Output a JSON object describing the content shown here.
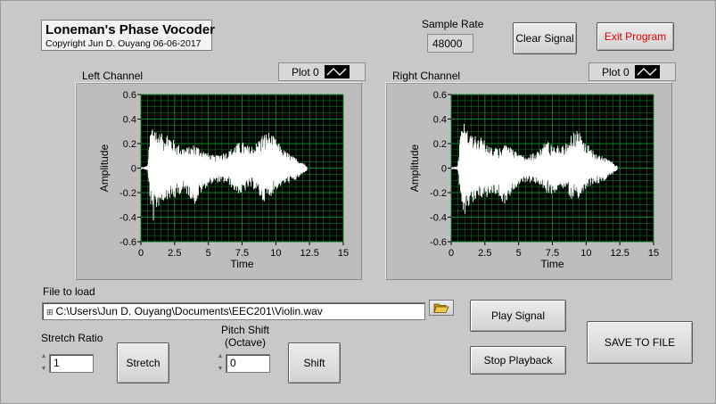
{
  "app": {
    "title": "Loneman's Phase Vocoder",
    "copyright": "Copyright Jun D. Ouyang 06-06-2017"
  },
  "sample_rate": {
    "label": "Sample Rate",
    "value": "48000"
  },
  "buttons": {
    "clear_signal": "Clear Signal",
    "exit_program": "Exit Program",
    "play_signal": "Play Signal",
    "stop_playback": "Stop Playback",
    "save_to_file": "SAVE TO FILE",
    "stretch": "Stretch",
    "shift": "Shift"
  },
  "left_graph": {
    "label": "Left Channel",
    "plot_legend": "Plot 0"
  },
  "right_graph": {
    "label": "Right Channel",
    "plot_legend": "Plot 0"
  },
  "file": {
    "label": "File to load",
    "path": "C:\\Users\\Jun D. Ouyang\\Documents\\EEC201\\Violin.wav"
  },
  "stretch_ratio": {
    "label": "Stretch Ratio",
    "value": "1"
  },
  "pitch_shift": {
    "label_line1": "Pitch Shift",
    "label_line2": "(Octave)",
    "value": "0"
  },
  "colors": {
    "plot_background": "#000000",
    "grid": "#0b8a2a",
    "trace": "#ffffff",
    "exit_text": "#e00000"
  },
  "chart_data": [
    {
      "type": "line",
      "title": "Left Channel",
      "xlabel": "Time",
      "ylabel": "Amplitude",
      "xlim": [
        0,
        15
      ],
      "ylim": [
        -0.6,
        0.6
      ],
      "x_ticks": [
        "0",
        "2.5",
        "5",
        "7.5",
        "10",
        "12.5",
        "15"
      ],
      "y_ticks": [
        "0.6",
        "0.4",
        "0.2",
        "0",
        "-0.2",
        "-0.4",
        "-0.6"
      ],
      "grid": true,
      "series": [
        {
          "envelope_time": [
            0,
            0.5,
            0.7,
            0.9,
            1.2,
            1.6,
            2.0,
            2.5,
            3.0,
            3.5,
            4.0,
            4.5,
            5.0,
            5.5,
            6.0,
            6.5,
            7.0,
            7.5,
            8.0,
            8.5,
            9.0,
            9.5,
            10.0,
            10.5,
            11.0,
            11.5,
            12.0,
            12.3
          ],
          "envelope_upper": [
            0,
            0.02,
            0.3,
            0.4,
            0.3,
            0.28,
            0.3,
            0.22,
            0.18,
            0.17,
            0.2,
            0.16,
            0.12,
            0.1,
            0.13,
            0.14,
            0.2,
            0.22,
            0.18,
            0.2,
            0.28,
            0.3,
            0.24,
            0.16,
            0.12,
            0.08,
            0.05,
            0.02
          ],
          "envelope_lower": [
            0,
            -0.02,
            -0.3,
            -0.45,
            -0.33,
            -0.28,
            -0.25,
            -0.26,
            -0.2,
            -0.22,
            -0.3,
            -0.2,
            -0.14,
            -0.12,
            -0.12,
            -0.13,
            -0.2,
            -0.22,
            -0.16,
            -0.18,
            -0.28,
            -0.25,
            -0.18,
            -0.14,
            -0.12,
            -0.1,
            -0.05,
            -0.02
          ]
        }
      ]
    },
    {
      "type": "line",
      "title": "Right Channel",
      "xlabel": "Time",
      "ylabel": "Amplitude",
      "xlim": [
        0,
        15
      ],
      "ylim": [
        -0.6,
        0.6
      ],
      "x_ticks": [
        "0",
        "2.5",
        "5",
        "7.5",
        "10",
        "12.5",
        "15"
      ],
      "y_ticks": [
        "0.6",
        "0.4",
        "0.2",
        "0",
        "-0.2",
        "-0.4",
        "-0.6"
      ],
      "grid": true,
      "series": [
        {
          "envelope_time": [
            0,
            0.5,
            0.7,
            0.9,
            1.2,
            1.6,
            2.0,
            2.5,
            3.0,
            3.5,
            4.0,
            4.5,
            5.0,
            5.5,
            6.0,
            6.5,
            7.0,
            7.5,
            8.0,
            8.5,
            9.0,
            9.5,
            10.0,
            10.5,
            11.0,
            11.5,
            12.0,
            12.3
          ],
          "envelope_upper": [
            0,
            0.02,
            0.3,
            0.38,
            0.3,
            0.28,
            0.28,
            0.22,
            0.18,
            0.16,
            0.2,
            0.16,
            0.12,
            0.1,
            0.13,
            0.14,
            0.24,
            0.2,
            0.18,
            0.2,
            0.3,
            0.3,
            0.2,
            0.16,
            0.12,
            0.08,
            0.05,
            0.02
          ],
          "envelope_lower": [
            0,
            -0.02,
            -0.3,
            -0.44,
            -0.33,
            -0.28,
            -0.25,
            -0.26,
            -0.2,
            -0.22,
            -0.32,
            -0.2,
            -0.14,
            -0.12,
            -0.12,
            -0.13,
            -0.2,
            -0.22,
            -0.16,
            -0.18,
            -0.28,
            -0.25,
            -0.18,
            -0.14,
            -0.12,
            -0.1,
            -0.05,
            -0.02
          ]
        }
      ]
    }
  ]
}
